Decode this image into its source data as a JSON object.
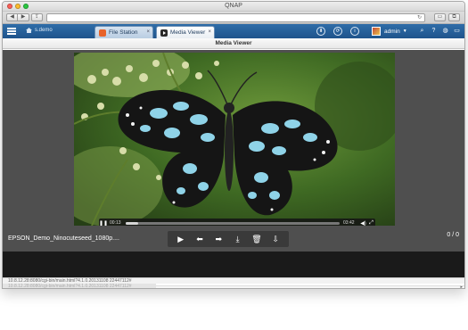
{
  "window": {
    "title": "QNAP"
  },
  "browser": {
    "back_icon": "chevron-left-icon",
    "forward_icon": "chevron-right-icon",
    "share_icon": "share-icon",
    "url_value": "",
    "reload_icon": "reload-icon"
  },
  "qnap": {
    "home_label": "s.demo",
    "tabs": [
      {
        "label": "File Station",
        "icon": "file-station-icon",
        "color": "#e8632a"
      },
      {
        "label": "Media Viewer",
        "icon": "media-viewer-icon",
        "color": "#2a2a2a"
      }
    ],
    "close_glyph": "×",
    "user": "admin",
    "accent": "#2460a0"
  },
  "viewer": {
    "title": "Media Viewer",
    "filename": "EPSON_Demo_Ninocuteseed_1080p....",
    "counter": "0 / 0",
    "time_current": "00:13",
    "time_duration": "03:42",
    "progress": 0.06
  },
  "status": {
    "url": "10.8.12.28:8080/cgi-bin/main.html?4.1.0.20131108 22447112#",
    "url2": "10.8.12.28:8080/cgi-bin/main.html?4.1.0.20131108 22447112#"
  }
}
